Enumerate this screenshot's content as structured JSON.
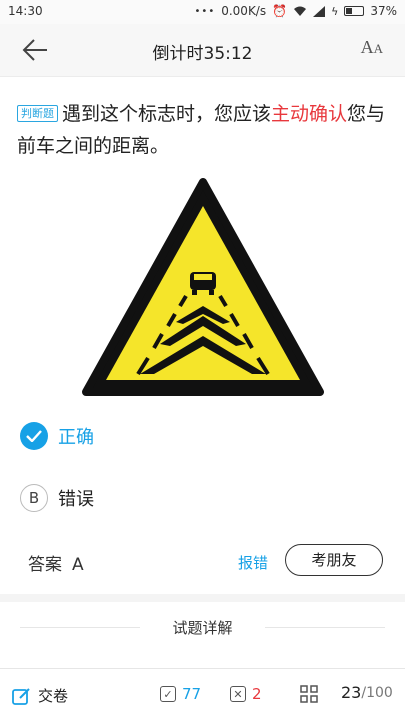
{
  "status_bar": {
    "time": "14:30",
    "network_speed": "0.00K/s",
    "battery": "37%"
  },
  "header": {
    "title": "倒计时35:12",
    "font_icon_label": "AA"
  },
  "question": {
    "tag": "判断题",
    "text_before": "遇到这个标志时，您应该",
    "highlight": "主动确认",
    "text_after": "您与前车之间的距离。"
  },
  "options": [
    {
      "letter": "A",
      "label": "正确",
      "selected": true
    },
    {
      "letter": "B",
      "label": "错误",
      "selected": false
    }
  ],
  "answer": {
    "label": "答案",
    "value": "A"
  },
  "actions": {
    "report": "报错",
    "ask_friend": "考朋友"
  },
  "detail_title": "试题详解",
  "bottom_bar": {
    "submit": "交卷",
    "correct_count": "77",
    "wrong_count": "2",
    "current": "23",
    "total": "/100"
  },
  "colors": {
    "accent": "#17a1e6",
    "error": "#e8383d",
    "sign_yellow": "#f5e52a"
  }
}
